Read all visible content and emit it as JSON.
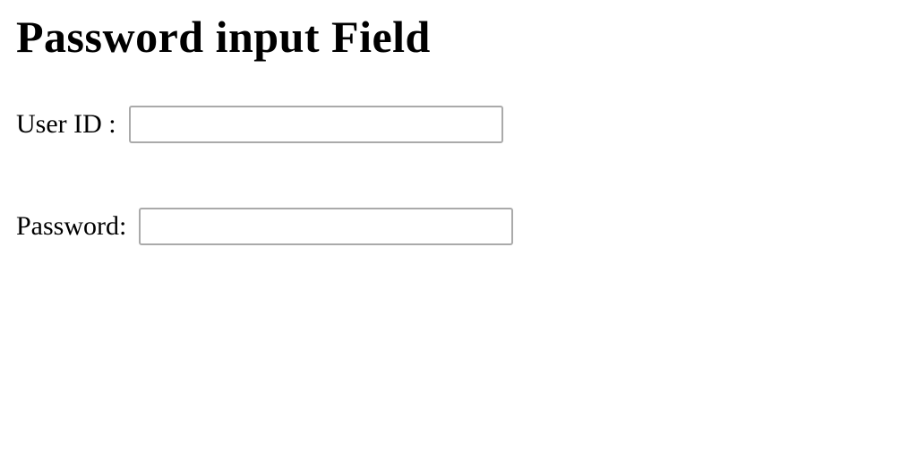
{
  "heading": {
    "text": "Password input Field"
  },
  "form": {
    "userId": {
      "label": "User ID :",
      "value": ""
    },
    "password": {
      "label": "Password:",
      "value": ""
    }
  }
}
